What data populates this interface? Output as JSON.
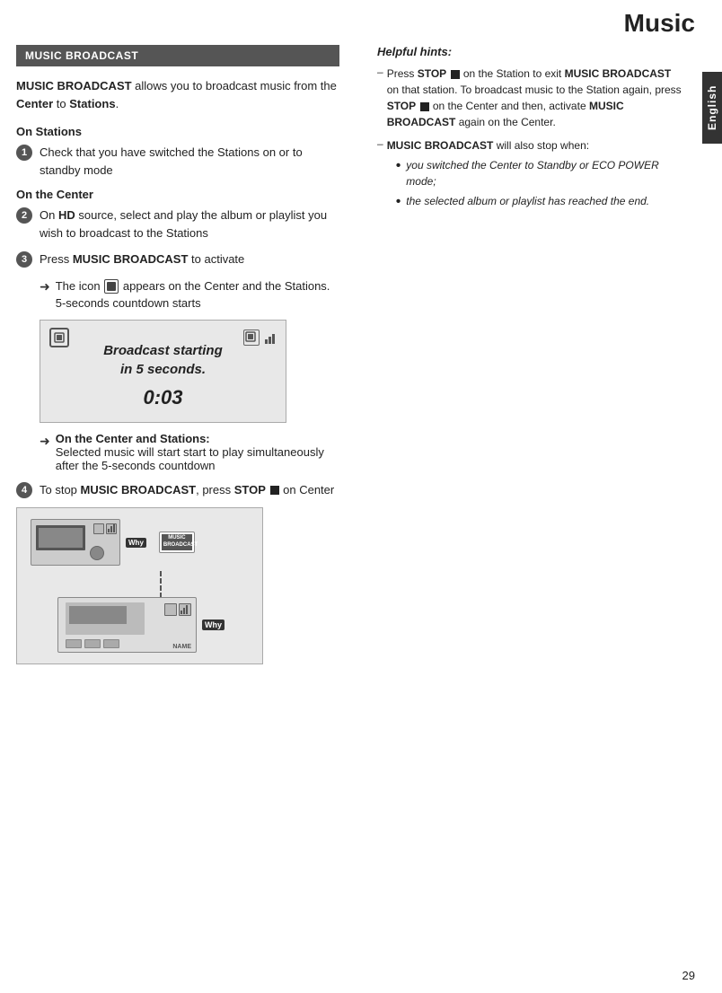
{
  "page": {
    "title": "Music",
    "page_number": "29",
    "language_tab": "English"
  },
  "section_header": "MUSIC BROADCAST",
  "intro": {
    "text_part1": "MUSIC BROADCAST",
    "text_part2": " allows you to broadcast music from the ",
    "text_center": "Center",
    "text_to": " to ",
    "text_stations": "Stations",
    "text_end": "."
  },
  "on_stations": {
    "heading": "On Stations",
    "step1_text": "Check that you have switched the Stations on or to standby mode"
  },
  "on_center": {
    "heading": "On the Center",
    "step2_text": "On HD source, select and play the album or playlist you wish to broadcast to the Stations",
    "step3_text": "Press MUSIC BROADCAST to activate",
    "arrow1_text": "The icon",
    "arrow1_text2": " appears on the Center and the Stations. 5-seconds countdown starts"
  },
  "broadcast_screen": {
    "text_line1": "Broadcast starting",
    "text_line2": "in 5 seconds.",
    "countdown": "0:03"
  },
  "on_center_stations": {
    "label": "On the Center and Stations:",
    "text": "Selected music will start start to play simultaneously after the 5-seconds countdown"
  },
  "step4": {
    "text_part1": "To stop ",
    "text_bold": "MUSIC BROADCAST",
    "text_part2": ", press ",
    "text_stop": "STOP",
    "text_part3": " on Center"
  },
  "helpful_hints": {
    "title": "Helpful hints:",
    "items": [
      {
        "dash": "–",
        "text_prefix": "Press ",
        "text_stop": "STOP",
        "text_body": " on the Station to exit ",
        "text_bold1": "MUSIC BROADCAST",
        "text_body2": " on that station. To broadcast music to the Station again, press ",
        "text_stop2": "STOP",
        "text_body3": " on the Center and then, activate ",
        "text_bold2": "MUSIC BROADCAST",
        "text_body4": " again on the Center."
      },
      {
        "dash": "–",
        "text_bold": "MUSIC BROADCAST",
        "text_body": " will also stop when:",
        "bullets": [
          "you switched the Center to Standby or ECO POWER mode;",
          "the selected album or playlist has reached the end."
        ]
      }
    ]
  }
}
